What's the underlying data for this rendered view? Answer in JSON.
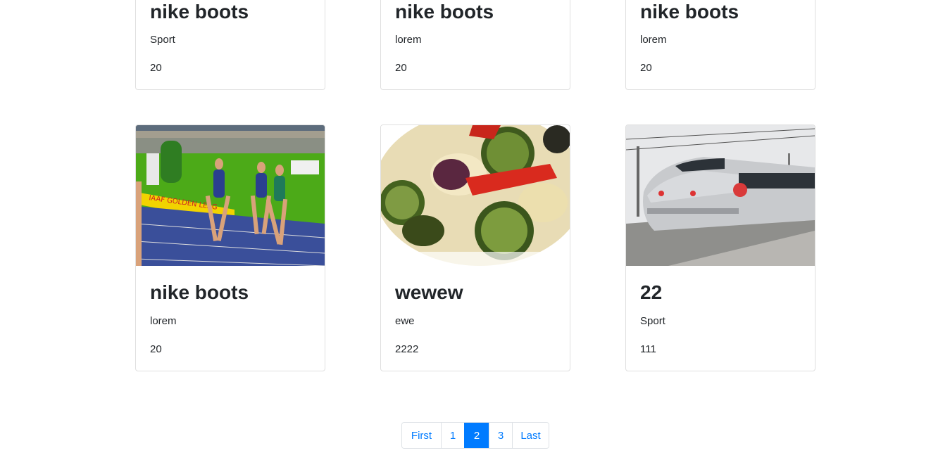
{
  "cards_top": [
    {
      "title": "nike boots",
      "category": "Sport",
      "price": "20"
    },
    {
      "title": "nike boots",
      "category": "lorem",
      "price": "20"
    },
    {
      "title": "nike boots",
      "category": "lorem",
      "price": "20"
    }
  ],
  "cards_bottom": [
    {
      "title": "nike boots",
      "category": "lorem",
      "price": "20",
      "image": "athletics-track-photo"
    },
    {
      "title": "wewew",
      "category": "ewe",
      "price": "2222",
      "image": "grilled-vegetables-photo"
    },
    {
      "title": "22",
      "category": "Sport",
      "price": "111",
      "image": "high-speed-train-photo"
    }
  ],
  "pagination": {
    "items": [
      "First",
      "1",
      "2",
      "3",
      "Last"
    ],
    "active": "2",
    "active_color": "#007bff"
  }
}
